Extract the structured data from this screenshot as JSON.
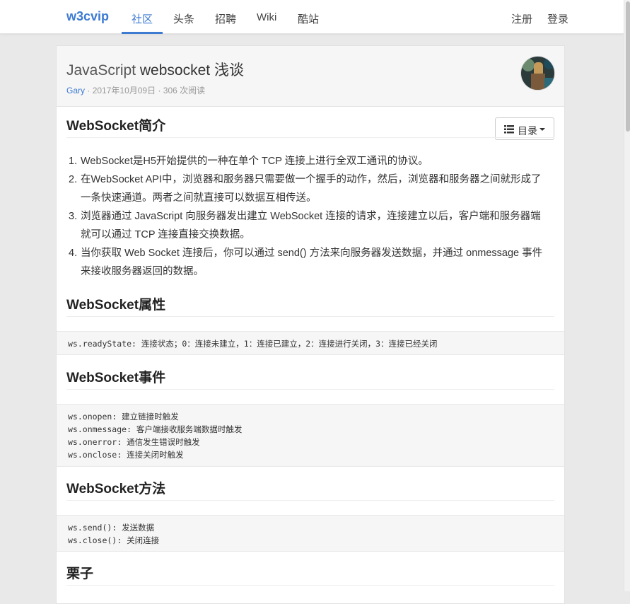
{
  "nav": {
    "brand": "w3cvip",
    "items": [
      "社区",
      "头条",
      "招聘",
      "Wiki",
      "酷站"
    ],
    "active_index": 0,
    "register": "注册",
    "login": "登录"
  },
  "article": {
    "title_a": "JavaScript",
    "title_b": "websocket 浅谈",
    "author": "Gary",
    "sep1": "·",
    "date": "2017年10月09日",
    "sep2": "·",
    "reads": "306 次阅读",
    "toc_label": "目录"
  },
  "sections": {
    "intro_title": "WebSocket简介",
    "intro_items": [
      "WebSocket是H5开始提供的一种在单个 TCP 连接上进行全双工通讯的协议。",
      "在WebSocket API中，浏览器和服务器只需要做一个握手的动作，然后，浏览器和服务器之间就形成了一条快速通道。两者之间就直接可以数据互相传送。",
      "浏览器通过 JavaScript 向服务器发出建立 WebSocket 连接的请求，连接建立以后，客户端和服务器端就可以通过 TCP 连接直接交换数据。",
      "当你获取 Web Socket 连接后，你可以通过 send() 方法来向服务器发送数据，并通过 onmessage 事件来接收服务器返回的数据。"
    ],
    "attr_title": "WebSocket属性",
    "attr_code": [
      "ws.readyState: 连接状态；0：连接未建立，1：连接已建立，2：连接进行关闭，3：连接已经关闭"
    ],
    "event_title": "WebSocket事件",
    "event_code": [
      "ws.onopen: 建立链接时触发",
      "ws.onmessage: 客户端接收服务端数据时触发",
      "ws.onerror: 通信发生错误时触发",
      "ws.onclose: 连接关闭时触发"
    ],
    "method_title": "WebSocket方法",
    "method_code": [
      "ws.send(): 发送数据",
      "ws.close(): 关闭连接"
    ],
    "example_title": "栗子"
  },
  "colors": {
    "accent": "#3d7ad1",
    "page_bg": "#e9e9e9",
    "code_bg": "#f6f6f6"
  }
}
